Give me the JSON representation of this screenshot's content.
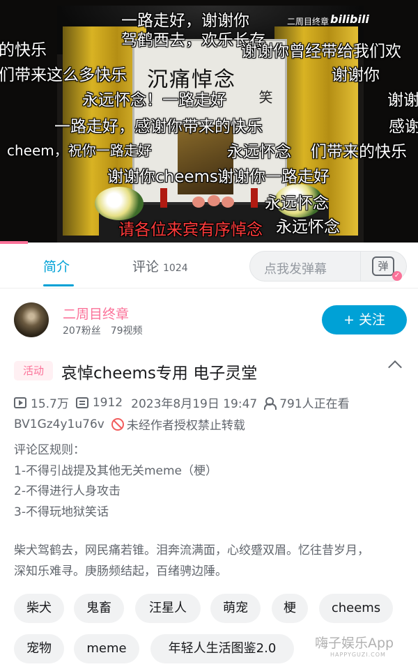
{
  "video": {
    "scroll_title": "沉痛悼念",
    "scroll_side": "笑",
    "watermark_channel": "二周目终章",
    "watermark_logo": "bilibili",
    "danmaku": [
      "一路走好，谢谢你",
      "驾鹤西去，欢乐长存",
      "的快乐",
      "谢谢你曾经带给我们欢",
      "们带来这么多快乐",
      "谢谢你",
      "永远怀念！一路走好",
      "谢谢",
      "一路走好，感谢你带来的快乐",
      "感谢",
      "cheem，祝你一路走好",
      "永远怀念",
      "们带来的快乐",
      "谢谢你cheems",
      "谢谢你一路走好",
      "永远怀念",
      "请各位来宾有序悼念",
      "永远怀念"
    ]
  },
  "tabs": {
    "intro": "简介",
    "comments": "评论",
    "comments_count": "1024",
    "danmaku_placeholder": "点我发弹幕",
    "danmaku_toggle": "弹"
  },
  "author": {
    "name": "二周目终章",
    "followers": "207粉丝",
    "videos": "79视频",
    "follow_label": "+ 关注"
  },
  "video_info": {
    "tag": "活动",
    "title": "哀悼cheems专用 电子灵堂",
    "views": "15.7万",
    "danmaku_count": "1912",
    "date": "2023年8月19日 19:47",
    "watching": "791人正在看",
    "bvid": "BV1Gz4y1u76v",
    "copyright": "未经作者授权禁止转载"
  },
  "description": {
    "rules_title": "评论区规则：",
    "rules": [
      "1-不得引战提及其他无关meme（梗）",
      "2-不得进行人身攻击",
      "3-不得玩地狱笑话"
    ],
    "poem_1": "柴犬驾鹤去，网民痛若锥。泪奔流满面，心绞蹙双眉。忆往昔岁月，",
    "poem_2": "深知乐难寻。庚肠频结起，百绪骋边陲。"
  },
  "tags": [
    "柴犬",
    "鬼畜",
    "汪星人",
    "萌宠",
    "梗",
    "cheems",
    "宠物",
    "meme",
    "年轻人生活图鉴2.0"
  ],
  "watermark": {
    "main": "嗨子娱乐App",
    "sub": "HAPPYGUZI.COM"
  },
  "colors": {
    "accent": "#00a1d6",
    "pink": "#fb7299",
    "text_secondary": "#61666d"
  }
}
